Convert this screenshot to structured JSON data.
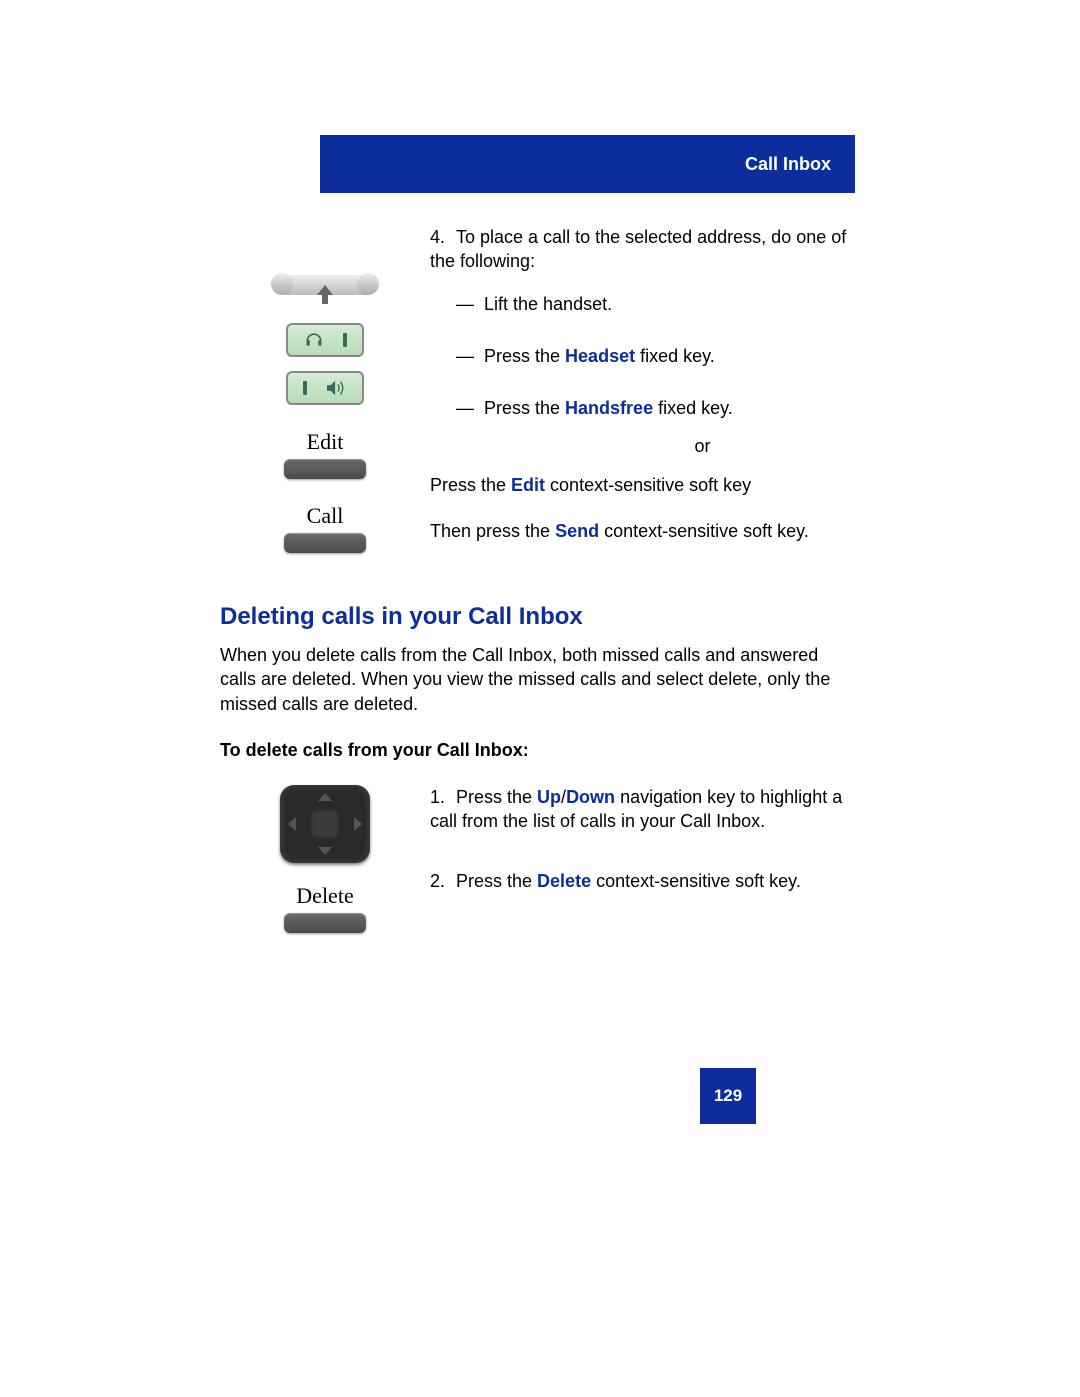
{
  "header": {
    "title": "Call Inbox"
  },
  "step4": {
    "number": "4.",
    "intro": "To place a call to the selected address, do one of the following:",
    "lift": "Lift the handset.",
    "headset_pre": "Press the ",
    "headset_kw": "Headset",
    "headset_post": " fixed key.",
    "handsfree_pre": "Press the ",
    "handsfree_kw": "Handsfree",
    "handsfree_post": " fixed key.",
    "or": "or",
    "edit_pre": "Press the ",
    "edit_kw": "Edit",
    "edit_post": " context-sensitive soft key",
    "send_pre": "Then press the ",
    "send_kw": "Send",
    "send_post": " context-sensitive soft key."
  },
  "softkeys": {
    "edit": "Edit",
    "call": "Call",
    "delete": "Delete"
  },
  "section": {
    "heading": "Deleting calls in your Call Inbox",
    "para": "When you delete calls from the Call Inbox, both missed calls and answered calls are deleted. When you view the missed calls and select delete, only the missed calls are deleted.",
    "subheading": "To delete calls from your Call Inbox:"
  },
  "delete_steps": {
    "s1_num": "1.",
    "s1_pre": "Press the ",
    "s1_kw1": "Up",
    "s1_slash": "/",
    "s1_kw2": "Down",
    "s1_post": " navigation key to highlight a call from the list of calls in your Call Inbox.",
    "s2_num": "2.",
    "s2_pre": "Press the ",
    "s2_kw": "Delete",
    "s2_post": " context-sensitive soft key."
  },
  "page_number": "129"
}
